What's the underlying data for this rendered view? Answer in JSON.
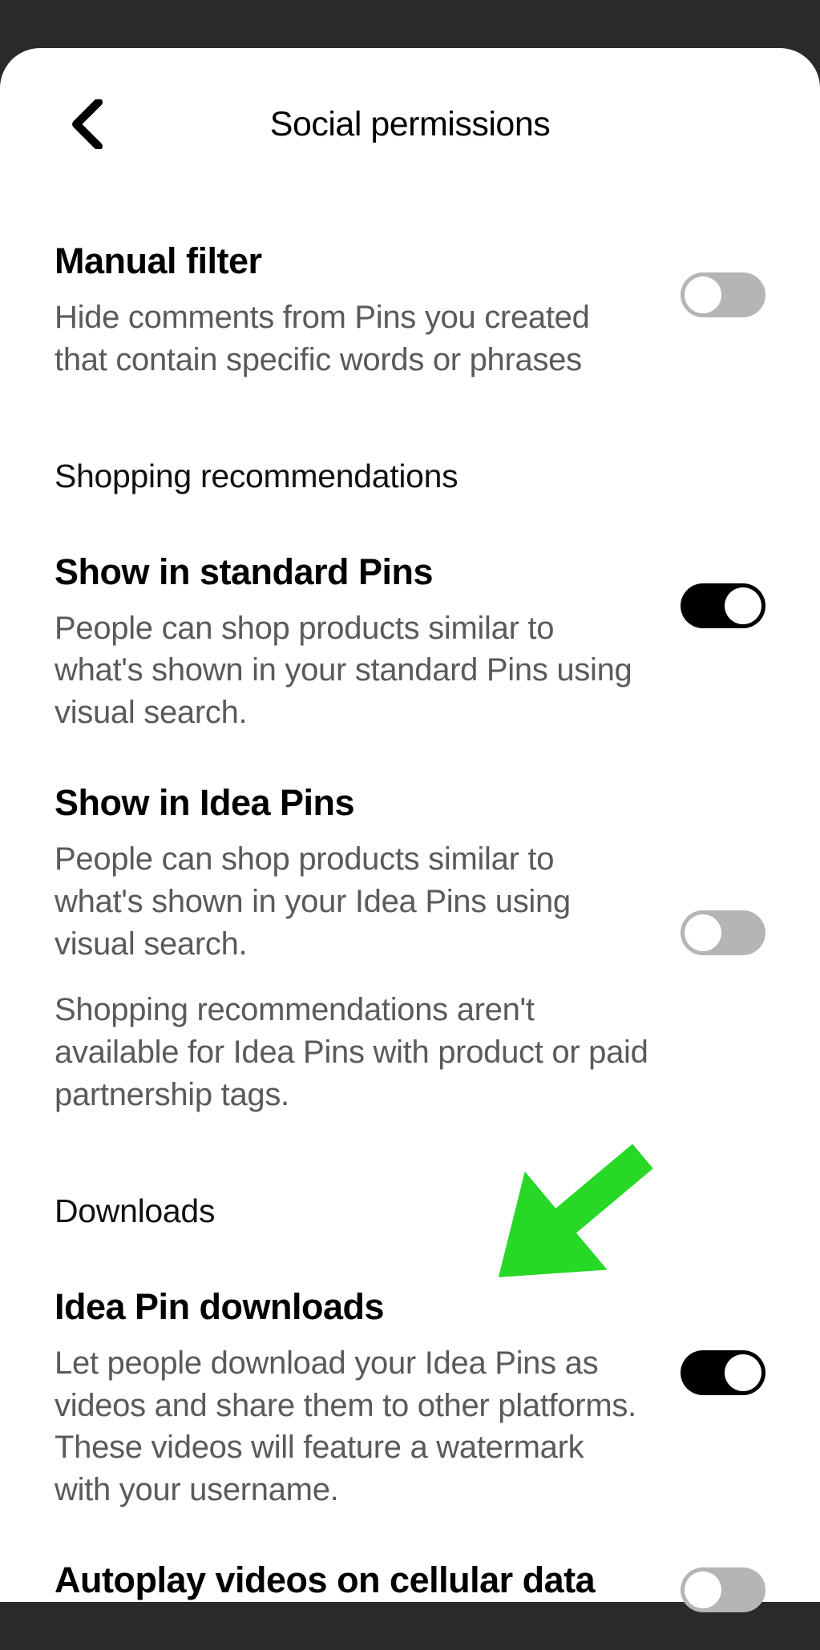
{
  "header": {
    "title": "Social permissions"
  },
  "settings": {
    "manual_filter": {
      "title": "Manual filter",
      "desc": "Hide comments from Pins you created that contain specific words or phrases",
      "enabled": false
    },
    "shopping_section": "Shopping recommendations",
    "standard_pins": {
      "title": "Show in standard Pins",
      "desc": "People can shop products similar to what's shown in your standard Pins using visual search.",
      "enabled": true
    },
    "idea_pins": {
      "title": "Show in Idea Pins",
      "desc": "People can shop products similar to what's shown in your Idea Pins using visual search.",
      "desc2": "Shopping recommendations aren't available for Idea Pins with product or paid partnership tags.",
      "enabled": false
    },
    "downloads_section": "Downloads",
    "idea_downloads": {
      "title": "Idea Pin downloads",
      "desc": "Let people download your Idea Pins as videos and share them to other platforms. These videos will feature a watermark with your username.",
      "enabled": true
    },
    "autoplay": {
      "title": "Autoplay videos on cellular data",
      "enabled": false
    }
  }
}
